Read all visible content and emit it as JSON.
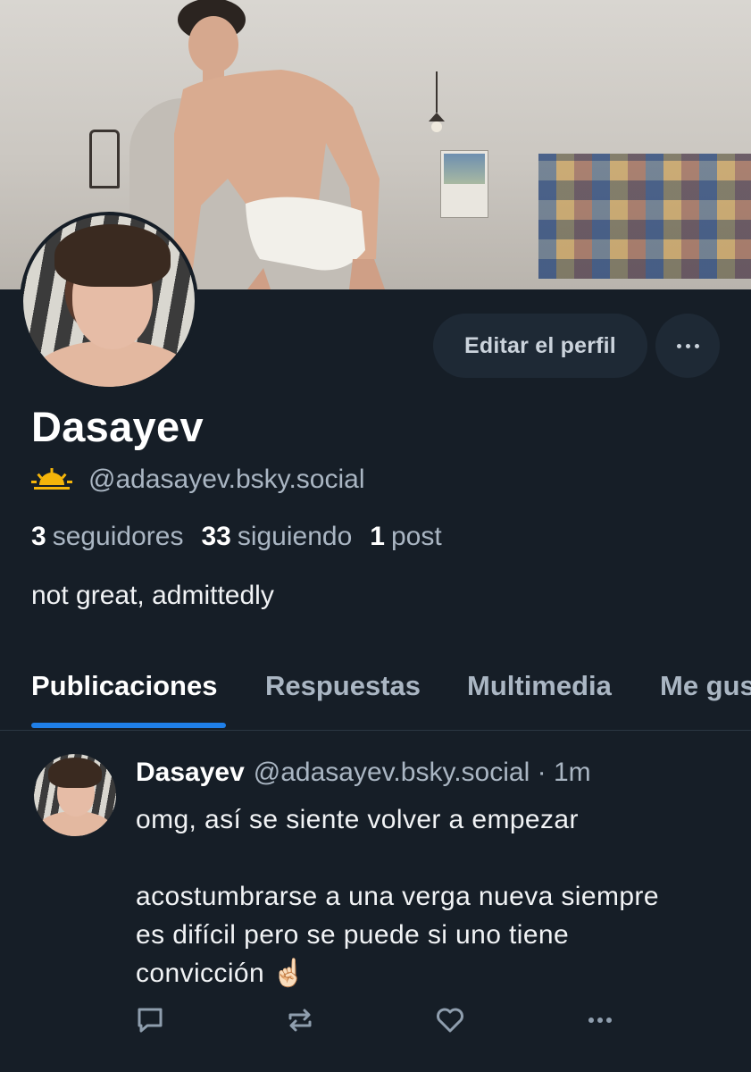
{
  "profile": {
    "display_name": "Dasayev",
    "handle": "@adasayev.bsky.social",
    "status_icon": "sunrise-emoji",
    "followers_count": "3",
    "followers_label": "seguidores",
    "following_count": "33",
    "following_label": "siguiendo",
    "posts_count": "1",
    "posts_label": "post",
    "bio": "not great, admittedly",
    "edit_button_label": "Editar el perfil"
  },
  "tabs": [
    {
      "label": "Publicaciones",
      "active": true
    },
    {
      "label": "Respuestas",
      "active": false
    },
    {
      "label": "Multimedia",
      "active": false
    },
    {
      "label": "Me gus",
      "active": false
    }
  ],
  "post": {
    "author": "Dasayev",
    "handle": "@adasayev.bsky.social",
    "separator": "·",
    "time": "1m",
    "line1": "omg, así se siente volver a empezar",
    "line2": "acostumbrarse a una verga nueva siempre",
    "line3": "es difícil pero se puede si uno tiene",
    "line4": "convicción ☝🏻"
  },
  "colors": {
    "background": "#161e27",
    "accent": "#1f7fe8",
    "muted_text": "#aab6c3",
    "button_bg": "#1e2935"
  }
}
